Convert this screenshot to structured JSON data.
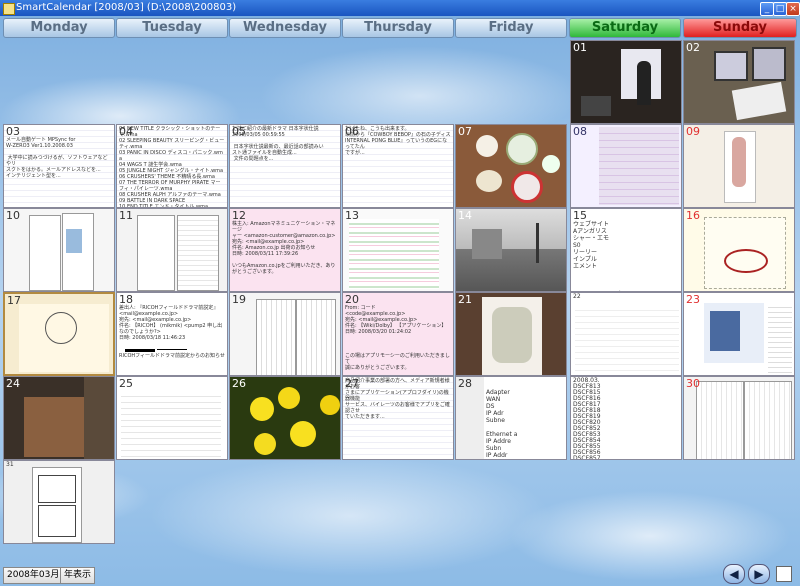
{
  "window": {
    "title": "SmartCalendar [2008/03] (D:\\2008\\200803)",
    "min": "_",
    "max": "□",
    "close": "×"
  },
  "days": [
    "Monday",
    "Tuesday",
    "Wednesday",
    "Thursday",
    "Friday",
    "Saturday",
    "Sunday"
  ],
  "colors": {
    "saturday": "#2fb83a",
    "sunday": "#e02020",
    "header": "#a8c6e4"
  },
  "cells": {
    "d01": "01",
    "d02": "02",
    "d03": "03",
    "d04": "04",
    "d05": "05",
    "d06": "06",
    "d07": "07",
    "d08": "08",
    "d09": "09",
    "d10": "10",
    "d11": "11",
    "d12": "12",
    "d13": "13",
    "d14": "14",
    "d15": "15",
    "d16": "16",
    "d17": "17",
    "d18": "18",
    "d19": "19",
    "d20": "20",
    "d21": "21",
    "d22": "22",
    "d23": "23",
    "d24": "24",
    "d25": "25",
    "d26": "26",
    "d27": "27",
    "d28": "28",
    "d29": "29",
    "d30": "30",
    "d31": "31"
  },
  "notes": {
    "n03": "メール自動ゲート MPSync for\nW-ZERO3 Ver1.10.2008.03 \n\n 大学中に読みつづけるが、ソフトウェアなどやリ\nスクトをはかる。メールアドレスなどを...\nインテリジェント型を...",
    "n04": "04 NEW TITLE クラシック・ショットのテーマ.wma\n02 SLEEPING BEAUTY スリーピング・ビューティ.wma\n03 PANIC IN DISCO ディスコ・パニック.wma\n04 WAGS T 謎生学会.wma\n05 JUNGLE NIGHT ジャングル・ナイト.wma\n06 CRUSHERS' THEME 不精晴る長.wma\n07 THE TERROR OF MURPHY PIRATE マーフィ・パイレーツ.wma\n08 CRUSHER ALPH アルファのテーマ.wma\n09 BATTLE IN DARK SPACE\n10 END TITLE エンド・タイトル.wma",
    "n05": "だ誌に紹介の最新ドラマ 日本字状仕説\n2008/03/05 00:59:55\n\n 日本字状仕説最新の、最近話の部読みい\nスト通ファイルを自動生成...\n 文件の問題点を...",
    "n06": "だばたね、こうも出来ます。\n以前から『COWBOY BEBOP』の石の子ディス\nINTERNAL PONG BLUE』っていうのEGになってたん\nですが...",
    "n12": "株主入: Amazonマネミュニケーション・マネージ\nャー <amazon-customer@amazon.co.jp>\n宛先: <mail@example.co.jp>\n件名: Amazon.co.jp 出荷のお知らせ\n日時: 2008/03/11 17:39:26\n\nいつもAmazon.co.jpをご利用いただき、ありがとうございます。",
    "n18": "差出人: 『RICOHフィールドドラマ前説定』\n<mail@example.co.jp>\n宛先: <mail@example.co.jp>\n件名: 【RICOH】 (mikmik) <pump2 申し出なのでしょうか?>\n日時: 2008/03/18 11:46:23\n\n\nRICOHフィールドドラマ前説定からのお知らせ",
    "n20": "From: コード\n<code@example.co.jp>\n宛先: <mail@example.co.jp>\n件名: 【Wiki/Dolby】 【アプリケーション】\n日時: 2008/03/20 01:24:02\n\n\n\nこの場はアプリモーシーのご利用いただきまして\n誠にありがとうございます。",
    "n27": "商品紹介事業の部署の方へ、メディア新規者様がお客\nさまにアプリケーション(アプロフダイリ)の機器機能\nサービス、バイレーツのお客様でアプリをご確認させ\nていただきます...",
    "n28": "Adapter\nWAN\nDS\nIP Adr\nSubne\n\nEthernet a\nIP Addre\nSubn\nIP Addr\nSubne",
    "n29": "2008.03.\nDSCF813\nDSCF815\nDSCF816\nDSCF817\nDSCF818\nDSCF819\nDSCF820\nDSCF852\nDSCF853\nDSCF854\nDSCF855\nDSCF856\nDSCF857\n              DSCF356",
    "n15": "ウェブサイト\nAアンガリス\nシャー・エモ\nS0\nリーリー\nインプル\nエメント\n\n\n\n                       変更"
  },
  "bottom": {
    "month": "2008年03月",
    "year_view": "年表示",
    "prev": "◀",
    "next": "▶"
  }
}
